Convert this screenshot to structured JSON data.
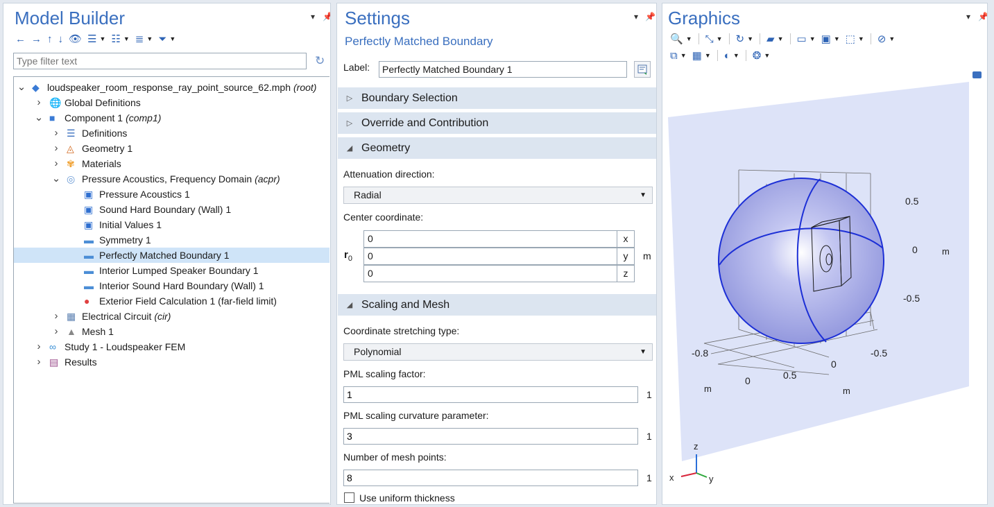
{
  "model_builder": {
    "title": "Model Builder",
    "filter_placeholder": "Type filter text",
    "toolbar": [
      "arrow-left-icon",
      "arrow-right-icon",
      "arrow-up-icon",
      "arrow-down-icon",
      "show-icon",
      "expand-icon",
      "collapse-icon",
      "list-icon",
      "filter-icon"
    ],
    "tree": [
      {
        "label": "loudspeaker_room_response_ray_point_source_62.mph",
        "suffix": "(root)",
        "level": 0,
        "caret": "v",
        "icon": "mph-file-icon"
      },
      {
        "label": "Global Definitions",
        "suffix": "",
        "level": 1,
        "caret": ">",
        "icon": "globe-icon"
      },
      {
        "label": "Component 1",
        "suffix": "(comp1)",
        "level": 1,
        "caret": "v",
        "icon": "component-icon"
      },
      {
        "label": "Definitions",
        "suffix": "",
        "level": 2,
        "caret": ">",
        "icon": "definitions-icon"
      },
      {
        "label": "Geometry 1",
        "suffix": "",
        "level": 2,
        "caret": ">",
        "icon": "geometry-icon"
      },
      {
        "label": "Materials",
        "suffix": "",
        "level": 2,
        "caret": ">",
        "icon": "materials-icon"
      },
      {
        "label": "Pressure Acoustics, Frequency Domain",
        "suffix": "(acpr)",
        "level": 2,
        "caret": "v",
        "icon": "acoustics-icon"
      },
      {
        "label": "Pressure Acoustics 1",
        "suffix": "",
        "level": 3,
        "caret": "",
        "icon": "domain-feature-icon"
      },
      {
        "label": "Sound Hard Boundary (Wall) 1",
        "suffix": "",
        "level": 3,
        "caret": "",
        "icon": "boundary-default-icon"
      },
      {
        "label": "Initial Values 1",
        "suffix": "",
        "level": 3,
        "caret": "",
        "icon": "initial-values-icon"
      },
      {
        "label": "Symmetry 1",
        "suffix": "",
        "level": 3,
        "caret": "",
        "icon": "boundary-icon"
      },
      {
        "label": "Perfectly Matched Boundary 1",
        "suffix": "",
        "level": 3,
        "caret": "",
        "icon": "boundary-icon",
        "selected": true
      },
      {
        "label": "Interior Lumped Speaker Boundary 1",
        "suffix": "",
        "level": 3,
        "caret": "",
        "icon": "boundary-icon"
      },
      {
        "label": "Interior Sound Hard Boundary (Wall) 1",
        "suffix": "",
        "level": 3,
        "caret": "",
        "icon": "boundary-icon"
      },
      {
        "label": "Exterior Field Calculation 1 (far-field limit)",
        "suffix": "",
        "level": 3,
        "caret": "",
        "icon": "exterior-field-icon"
      },
      {
        "label": "Electrical Circuit",
        "suffix": "(cir)",
        "level": 2,
        "caret": ">",
        "icon": "circuit-icon"
      },
      {
        "label": "Mesh 1",
        "suffix": "",
        "level": 2,
        "caret": ">",
        "icon": "mesh-icon"
      },
      {
        "label": "Study 1 - Loudspeaker FEM",
        "suffix": "",
        "level": 1,
        "caret": ">",
        "icon": "study-icon"
      },
      {
        "label": "Results",
        "suffix": "",
        "level": 1,
        "caret": ">",
        "icon": "results-icon"
      }
    ]
  },
  "settings": {
    "title": "Settings",
    "subtitle": "Perfectly Matched Boundary",
    "label_caption": "Label:",
    "label_value": "Perfectly Matched Boundary 1",
    "sections": {
      "boundary_selection": "Boundary Selection",
      "override": "Override and Contribution",
      "geometry": "Geometry",
      "scaling": "Scaling and Mesh"
    },
    "attenuation_label": "Attenuation direction:",
    "attenuation_value": "Radial",
    "center_label": "Center coordinate:",
    "center_symbol": "r",
    "center_subscript": "0",
    "center_unit": "m",
    "center": [
      {
        "value": "0",
        "axis": "x"
      },
      {
        "value": "0",
        "axis": "y"
      },
      {
        "value": "0",
        "axis": "z"
      }
    ],
    "stretch_label": "Coordinate stretching type:",
    "stretch_value": "Polynomial",
    "pml_factor_label": "PML scaling factor:",
    "pml_factor_value": "1",
    "pml_factor_unit": "1",
    "pml_curv_label": "PML scaling curvature parameter:",
    "pml_curv_value": "3",
    "pml_curv_unit": "1",
    "mesh_points_label": "Number of mesh points:",
    "mesh_points_value": "8",
    "mesh_points_unit": "1",
    "uniform_label": "Use uniform thickness",
    "uniform_checked": false
  },
  "graphics": {
    "title": "Graphics",
    "z_ticks": [
      "0.5",
      "0",
      "-0.5"
    ],
    "z_unit": "m",
    "x_ticks": [
      "-0.8",
      "0.5",
      "0"
    ],
    "x_unit": "m",
    "y_ticks": [
      "-0.5",
      "0"
    ],
    "y_unit": "m",
    "triad": {
      "x": "x",
      "y": "y",
      "z": "z"
    },
    "colors": {
      "sphere": "#a7abe9",
      "edges": "#1c2fd6",
      "background_plane": "#dde3f8"
    }
  }
}
